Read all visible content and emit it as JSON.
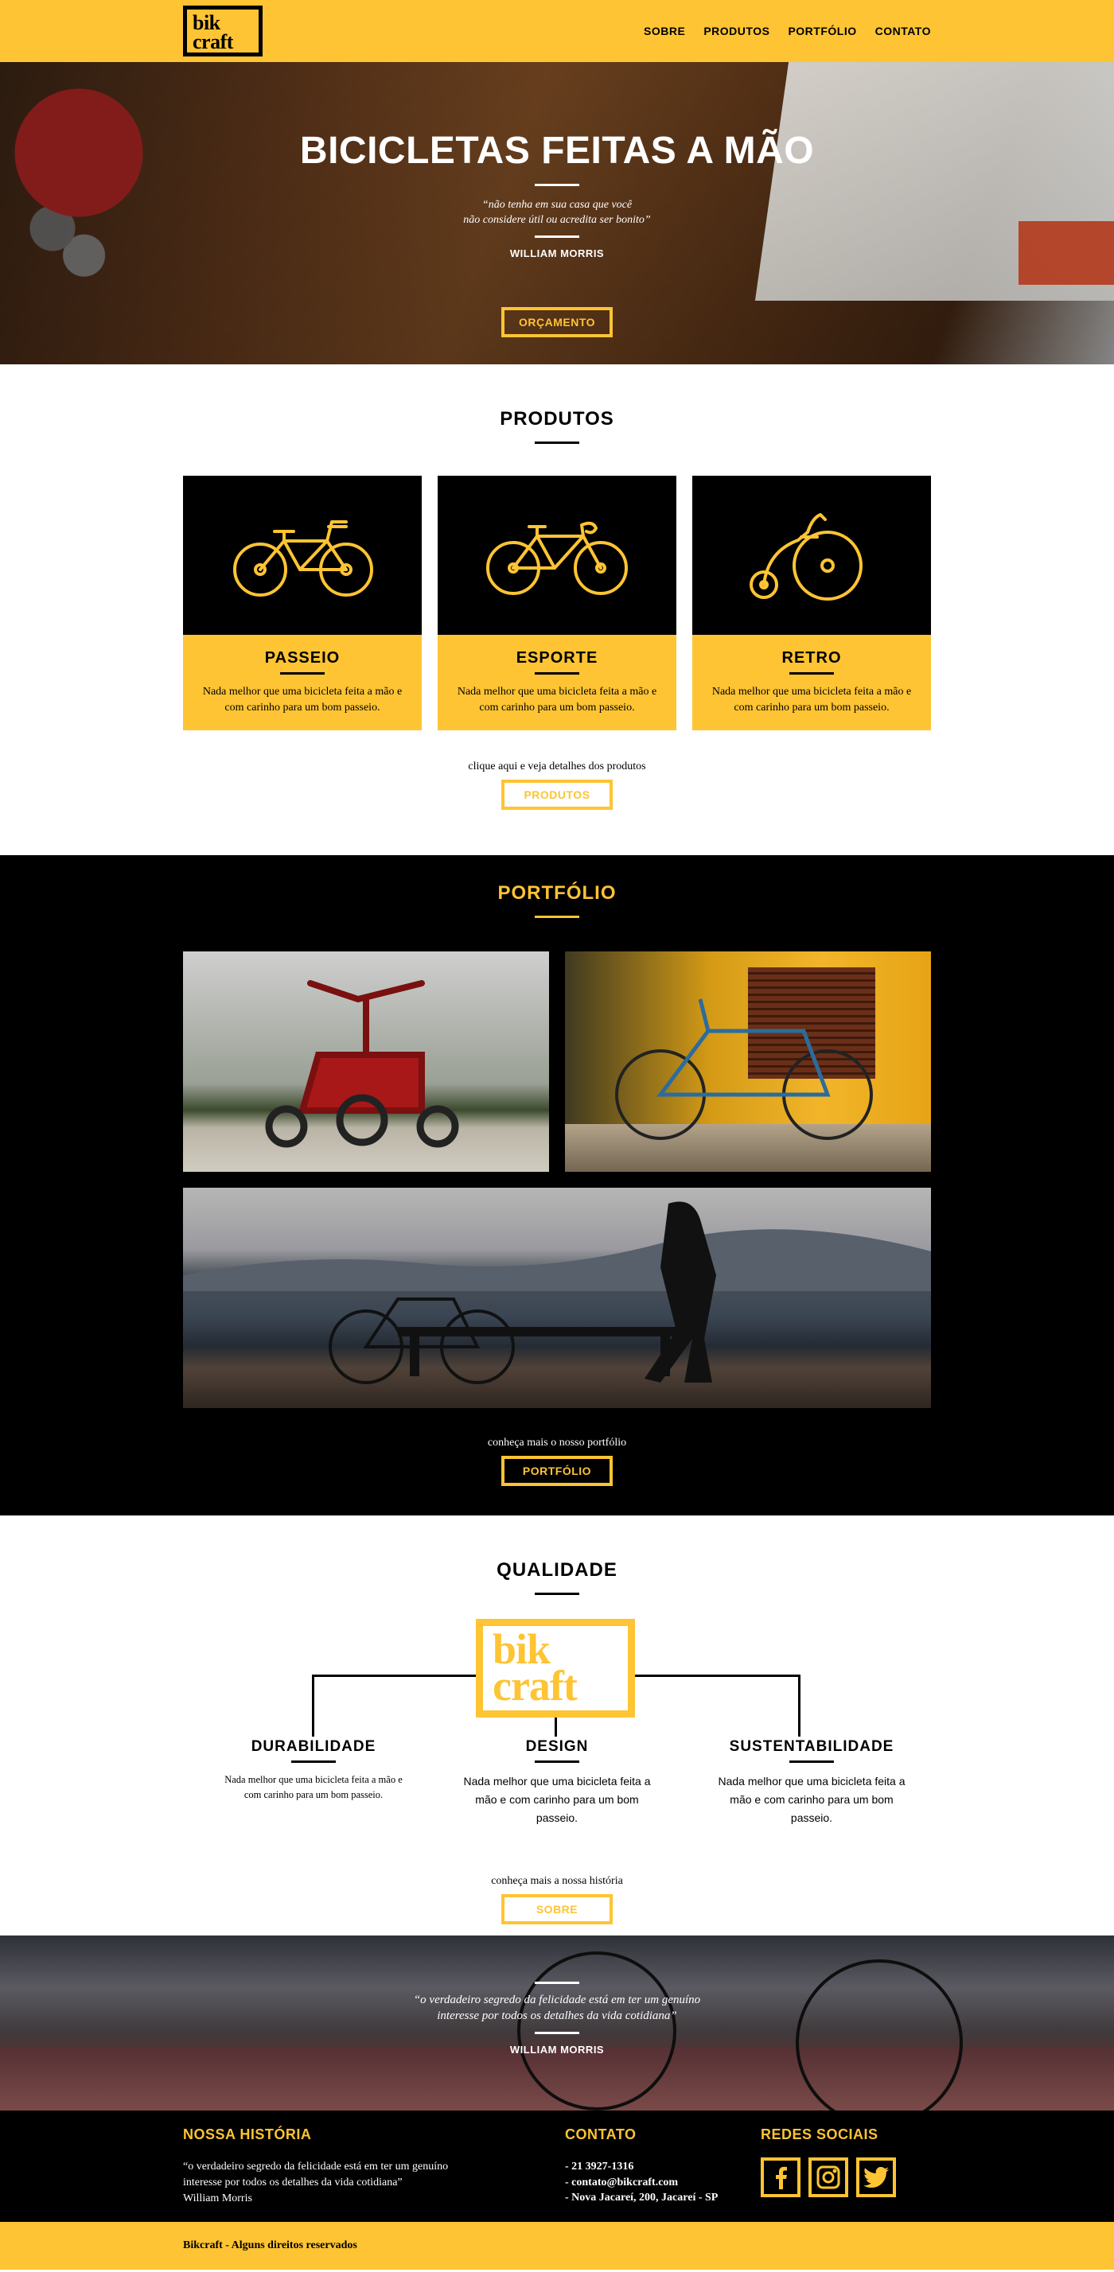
{
  "header": {
    "logo_line1": "bik",
    "logo_line2": "craft",
    "nav": [
      "SOBRE",
      "PRODUTOS",
      "PORTFÓLIO",
      "CONTATO"
    ]
  },
  "hero": {
    "title": "BICICLETAS FEITAS A MÃO",
    "quote_line1": "“não tenha em sua casa que você",
    "quote_line2": "não considere útil ou acredita ser bonito”",
    "author": "WILLIAM MORRIS",
    "button": "ORÇAMENTO"
  },
  "produtos": {
    "title": "PRODUTOS",
    "items": [
      {
        "name": "PASSEIO",
        "icon": "city-bicycle-icon",
        "text": "Nada melhor que uma bicicleta feita a mão e com carinho para um bom passeio."
      },
      {
        "name": "ESPORTE",
        "icon": "sport-bicycle-icon",
        "text": "Nada melhor que uma bicicleta feita a mão e com carinho para um bom passeio."
      },
      {
        "name": "RETRO",
        "icon": "penny-farthing-icon",
        "text": "Nada melhor que uma bicicleta feita a mão e com carinho para um bom passeio."
      }
    ],
    "cta_text": "clique aqui e veja detalhes dos produtos",
    "cta_button": "PRODUTOS"
  },
  "portfolio": {
    "title": "PORTFÓLIO",
    "photos": [
      "red-tricycle-photo",
      "blue-bicycle-yellow-wall-photo",
      "bicycle-by-the-sea-photo"
    ],
    "cta_text": "conheça mais o nosso portfólio",
    "cta_button": "PORTFÓLIO"
  },
  "qualidade": {
    "title": "QUALIDADE",
    "logo_line1": "bik",
    "logo_line2": "craft",
    "items": [
      {
        "name": "DURABILIDADE",
        "text": "Nada melhor que uma bicicleta feita a mão e com carinho para um bom passeio."
      },
      {
        "name": "DESIGN",
        "text": "Nada melhor que uma bicicleta feita a mão e com carinho para um bom passeio."
      },
      {
        "name": "SUSTENTABILIDADE",
        "text": "Nada melhor que uma bicicleta feita a mão e com carinho para um bom passeio."
      }
    ],
    "cta_text": "conheça mais a nossa história",
    "cta_button": "SOBRE"
  },
  "banner": {
    "quote_line1": "“o verdadeiro segredo da felicidade está em ter um genuíno",
    "quote_line2": "interesse por todos os detalhes da vida cotidiana”",
    "author": "WILLIAM MORRIS"
  },
  "footer": {
    "historia_title": "NOSSA HISTÓRIA",
    "historia_line1": "“o verdadeiro segredo da felicidade está em ter um genuíno",
    "historia_line2": "interesse por todos os detalhes da vida cotidiana”",
    "historia_author": "William Morris",
    "contato_title": "CONTATO",
    "contato": [
      "- 21 3927-1316",
      "- contato@bikcraft.com",
      "- Nova Jacareí, 200, Jacareí - SP"
    ],
    "social_title": "REDES SOCIAIS",
    "social": [
      "facebook-icon",
      "instagram-icon",
      "twitter-icon"
    ],
    "copyright": "Bikcraft - Alguns direitos reservados"
  },
  "colors": {
    "accent": "#FEC433",
    "dark": "#000000"
  }
}
